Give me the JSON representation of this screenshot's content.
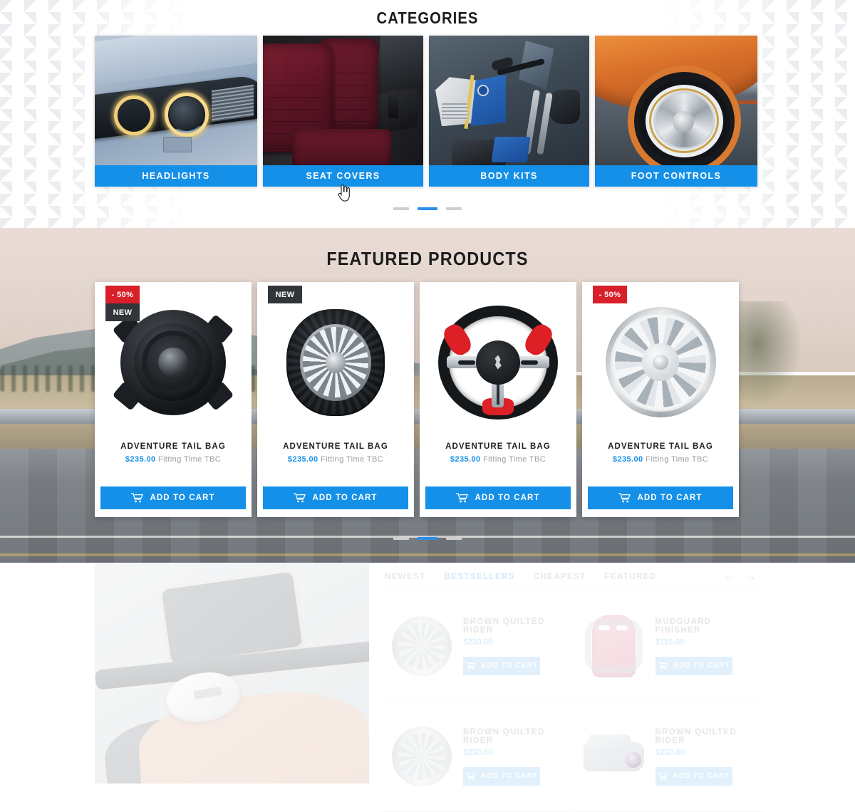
{
  "categories_section": {
    "title": "CATEGORIES",
    "items": [
      {
        "label": "HEADLIGHTS",
        "image": "car-headlight-photo"
      },
      {
        "label": "SEAT COVERS",
        "image": "burgundy-leather-seats-photo"
      },
      {
        "label": "BODY KITS",
        "image": "blue-white-motorcycle-photo"
      },
      {
        "label": "FOOT CONTROLS",
        "image": "orange-muscle-car-wheel-photo"
      }
    ],
    "carousel": {
      "slides": 3,
      "active_index": 1
    },
    "cursor": "pointer-hand-cursor"
  },
  "featured_section": {
    "title": "FEATURED PRODUCTS",
    "background": "blurred-highway-landscape-photo",
    "add_to_cart_label": "ADD TO CART",
    "cart_icon": "shopping-cart-icon",
    "products": [
      {
        "name": "ADVENTURE TAIL BAG",
        "price": "$235.00",
        "fitting": "Fitting Time TBC",
        "badges": [
          "- 50%",
          "NEW"
        ],
        "image": "car-speaker-photo"
      },
      {
        "name": "ADVENTURE TAIL BAG",
        "price": "$235.00",
        "fitting": "Fitting Time TBC",
        "badges": [
          "NEW"
        ],
        "image": "tire-photo"
      },
      {
        "name": "ADVENTURE TAIL BAG",
        "price": "$235.00",
        "fitting": "Fitting Time TBC",
        "badges": [],
        "image": "steering-wheel-photo"
      },
      {
        "name": "ADVENTURE TAIL BAG",
        "price": "$235.00",
        "fitting": "Fitting Time TBC",
        "badges": [
          "- 50%"
        ],
        "image": "alloy-wheel-photo"
      }
    ],
    "carousel": {
      "slides": 3,
      "active_index": 1
    }
  },
  "bottom_section": {
    "promo_image": "motorcycle-fuel-tank-photo",
    "tabs": [
      {
        "label": "NEWEST",
        "active": false
      },
      {
        "label": "BESTSELLERS",
        "active": true
      },
      {
        "label": "CHEAPEST",
        "active": false
      },
      {
        "label": "FEATURED",
        "active": false
      }
    ],
    "prev_arrow": "arrow-left-icon",
    "next_arrow": "arrow-right-icon",
    "add_to_cart_label": "ADD TO CART",
    "cart_icon": "shopping-cart-icon",
    "items": [
      {
        "name": "BROWN QUILTED RIDER",
        "price": "$230.00",
        "image": "alloy-wheel-photo"
      },
      {
        "name": "MUDGUARD FINISHER",
        "price": "$110.00",
        "image": "pink-racing-seat-photo"
      },
      {
        "name": "BROWN QUILTED RIDER",
        "price": "$230.00",
        "image": "alloy-wheel-photo"
      },
      {
        "name": "BROWN QUILTED RIDER",
        "price": "$230.00",
        "image": "dashcam-photo"
      }
    ]
  },
  "colors": {
    "accent_blue": "#1590e8",
    "sale_red": "#d81f2a",
    "new_dark": "#32363a",
    "muted_gray": "#9aa0a6"
  }
}
